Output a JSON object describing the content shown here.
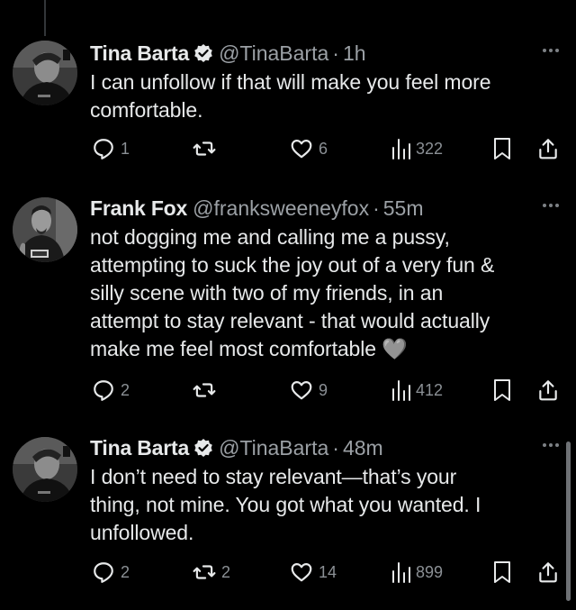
{
  "tweets": [
    {
      "name": "Tina Barta",
      "verified": true,
      "handle": "@TinaBarta",
      "separator": "·",
      "time": "1h",
      "text": "I can unfollow if that will make you feel more\ncomfortable.",
      "replies": "1",
      "retweets": "",
      "likes": "6",
      "views": "322"
    },
    {
      "name": "Frank Fox",
      "verified": false,
      "handle": "@franksweeneyfox",
      "separator": "·",
      "time": "55m",
      "text": "not dogging me and calling me a pussy,\nattempting to suck the joy out of a very fun &\nsilly scene with two of my friends, in an\nattempt to stay relevant - that would actually\nmake me feel most comfortable 🩶",
      "replies": "2",
      "retweets": "",
      "likes": "9",
      "views": "412"
    },
    {
      "name": "Tina Barta",
      "verified": true,
      "handle": "@TinaBarta",
      "separator": "·",
      "time": "48m",
      "text": "I don’t need to stay relevant—that’s your\nthing, not mine. You got what you wanted. I\nunfollowed.",
      "replies": "2",
      "retweets": "2",
      "likes": "14",
      "views": "899"
    }
  ],
  "icons": {
    "reply": "reply-icon",
    "retweet": "retweet-icon",
    "like": "heart-icon",
    "views": "views-chart-icon",
    "bookmark": "bookmark-icon",
    "share": "share-icon",
    "more": "more-options-icon",
    "verified": "verified-badge-icon"
  },
  "colors": {
    "background": "#000000",
    "text": "#e7e9ea",
    "muted": "#9ba0a5",
    "verified_badge": "#e7e9ea"
  }
}
